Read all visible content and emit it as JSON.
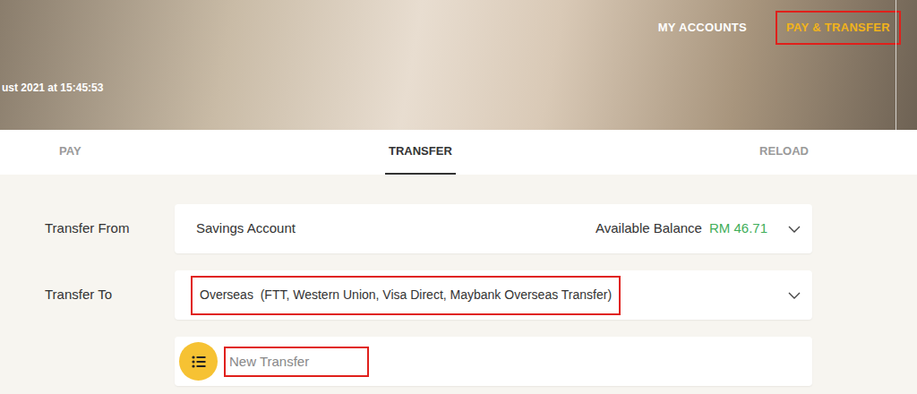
{
  "banner": {
    "timestamp": "ust 2021 at 15:45:53"
  },
  "nav": [
    {
      "label": "MY ACCOUNTS",
      "selected": false,
      "highlighted": false
    },
    {
      "label": "PAY & TRANSFER",
      "selected": true,
      "highlighted": true
    }
  ],
  "tabs": [
    {
      "label": "PAY",
      "selected": false
    },
    {
      "label": "TRANSFER",
      "selected": true
    },
    {
      "label": "RELOAD",
      "selected": false
    }
  ],
  "transfer_from": {
    "label": "Transfer From",
    "account": "Savings Account",
    "balance_label": "Available Balance",
    "balance": "RM 46.71"
  },
  "transfer_to": {
    "label": "Transfer To",
    "value": "Overseas  (FTT, Western Union, Visa Direct, Maybank Overseas Transfer)",
    "highlighted": true
  },
  "recipient": {
    "placeholder": "New Transfer",
    "highlighted": true
  }
}
